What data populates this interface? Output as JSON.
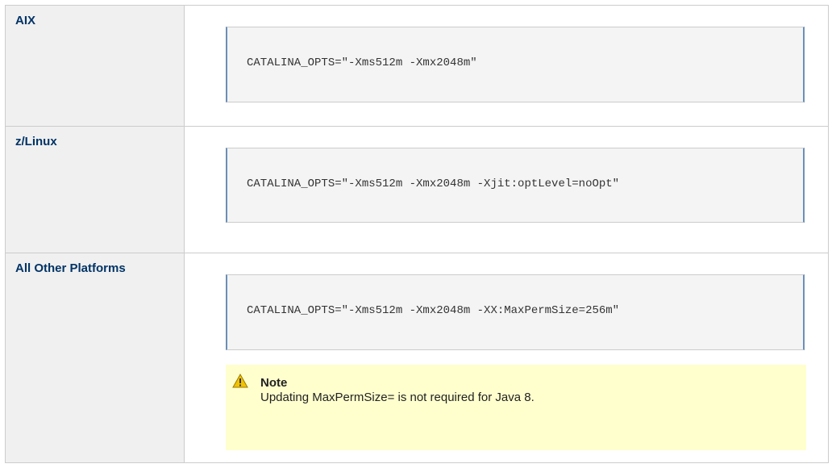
{
  "rows": [
    {
      "platform": "AIX",
      "code": "CATALINA_OPTS=\"-Xms512m -Xmx2048m\""
    },
    {
      "platform": "z/Linux",
      "code": "CATALINA_OPTS=\"-Xms512m -Xmx2048m -Xjit:optLevel=noOpt\""
    },
    {
      "platform": "All Other Platforms",
      "code": "CATALINA_OPTS=\"-Xms512m -Xmx2048m -XX:MaxPermSize=256m\""
    }
  ],
  "note": {
    "icon": "warning-icon",
    "title": "Note",
    "text": "Updating MaxPermSize= is not required for Java 8."
  },
  "colors": {
    "label": "#003366",
    "header_bg": "#f0f0f0",
    "code_bg": "#f4f4f4",
    "code_accent": "#6b8fb8",
    "note_bg": "#ffffce"
  }
}
